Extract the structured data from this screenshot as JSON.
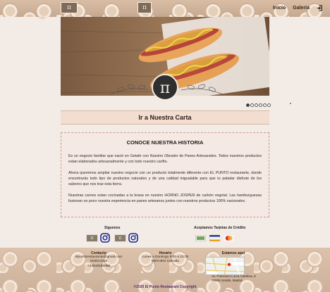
{
  "header": {
    "nav": [
      {
        "label": "Inicio"
      },
      {
        "label": "Galería"
      }
    ],
    "login_icon": "login-icon"
  },
  "carousel": {
    "logo_symbol": "π",
    "slides": 6,
    "active": 0
  },
  "cta": {
    "label": "Ir a Nuestra Carta"
  },
  "history": {
    "title": "CONOCE NUESTRA HISTORIA",
    "p1": "Es un negocio familiar que nació en Getafe con Nuestro Obrador de Panes Artesanales. Todos nuestros productos estan elaborados artesanalmente y con todo nuestro cariño.",
    "p2": "Ahora queremos ampliar nuestro negocio con un producto totalmente diferente con EL PUNTO restaurante, donde encontrarás todo tipo de productos naturales y de una calidad inigualable para que tu paladar disfrute de los sabores que nos trae esta tierra.",
    "p3": "Nuestras carnes estan cocinadas a la brasa en nuestro HORNO JOSPER de carbón vegetal. Las hamburguesas fusionan un poco nuestra experiencia en panes artesanos juntos con nuestros productos 100% nacionales."
  },
  "social": {
    "title": "Siguenos"
  },
  "cards": {
    "title": "Aceptamos Tarjetas de Crédito"
  },
  "footer": {
    "contact": {
      "title": "Contacto",
      "email": "elpuntorestaurante@gmail.com",
      "phone1": "916014316",
      "phone2": "+34619159058"
    },
    "hours": {
      "title": "Horario",
      "line1": "Lunes a Domingo 9:00 a 23:00",
      "line2": "Miércoles Cerrado"
    },
    "location": {
      "title": "Estamos aquí",
      "address1": "Av. Francisco Lorca Calafera, 9",
      "address2": "28905 Getafe, Madrid"
    },
    "copyright": "©2020 El Punto Restaurant Copyright"
  },
  "colors": {
    "cta_bg": "#f2ddd0",
    "history_bg": "#f5e9e4",
    "copyright": "#5a2a6a"
  }
}
